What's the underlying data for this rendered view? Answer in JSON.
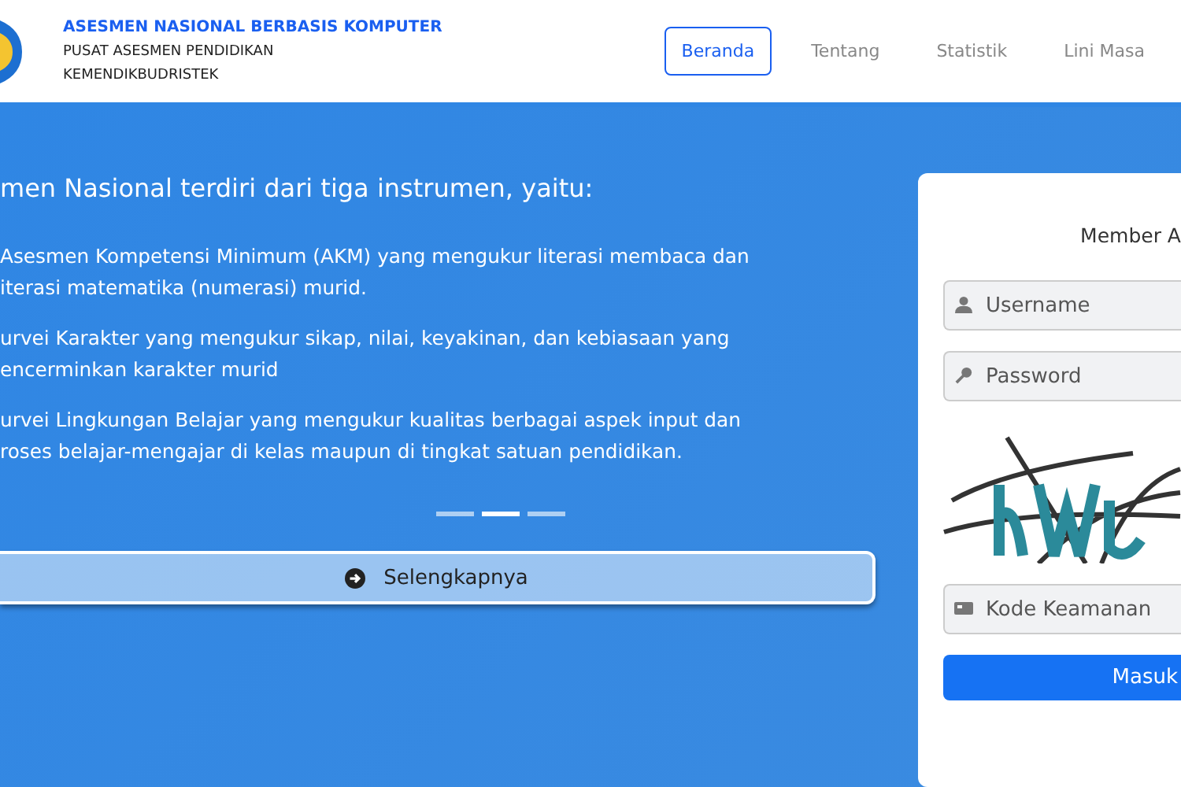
{
  "header": {
    "title": "ASESMEN NASIONAL BERBASIS KOMPUTER",
    "subtitle_1": "PUSAT ASESMEN PENDIDIKAN",
    "subtitle_2": "KEMENDIKBUDRISTEK",
    "nav": [
      {
        "label": "Beranda",
        "selected": true
      },
      {
        "label": "Tentang",
        "selected": false
      },
      {
        "label": "Statistik",
        "selected": false
      },
      {
        "label": "Lini Masa",
        "selected": false
      }
    ]
  },
  "hero": {
    "heading": "men Nasional terdiri dari tiga instrumen, yaitu:",
    "items": [
      [
        "Asesmen Kompetensi Minimum (AKM) yang mengukur literasi membaca dan",
        "iterasi matematika (numerasi) murid."
      ],
      [
        "urvei Karakter yang mengukur sikap, nilai, keyakinan, dan kebiasaan yang",
        "encerminkan karakter murid"
      ],
      [
        "urvei Lingkungan Belajar yang mengukur kualitas berbagai aspek input dan",
        "roses belajar-mengajar di kelas maupun di tingkat satuan pendidikan."
      ]
    ],
    "indicators": [
      {
        "selected": false
      },
      {
        "selected": true
      },
      {
        "selected": false
      }
    ],
    "more_button": "Selengkapnya"
  },
  "login": {
    "title": "Member A",
    "username": {
      "placeholder": "Username"
    },
    "password": {
      "placeholder": "Password"
    },
    "code": {
      "placeholder": "Kode Keamanan"
    },
    "submit": "Masuk"
  }
}
